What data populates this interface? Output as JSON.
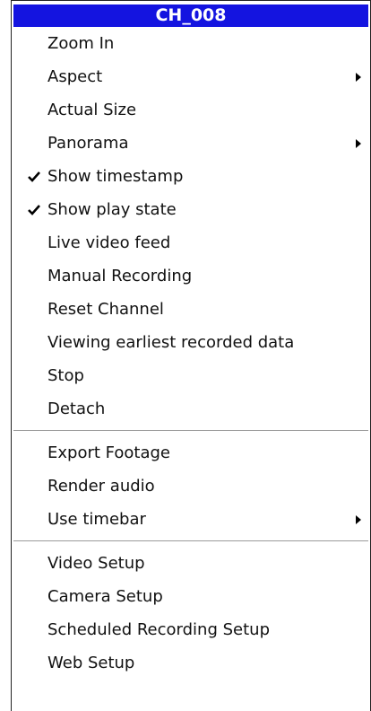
{
  "menu": {
    "title": "CH_008",
    "title_color": "#1414e0",
    "groups": [
      {
        "items": [
          {
            "label": "Zoom In",
            "checked": false,
            "submenu": false
          },
          {
            "label": "Aspect",
            "checked": false,
            "submenu": true
          },
          {
            "label": "Actual Size",
            "checked": false,
            "submenu": false
          },
          {
            "label": "Panorama",
            "checked": false,
            "submenu": true
          },
          {
            "label": "Show timestamp",
            "checked": true,
            "submenu": false
          },
          {
            "label": "Show play state",
            "checked": true,
            "submenu": false
          },
          {
            "label": "Live video feed",
            "checked": false,
            "submenu": false
          },
          {
            "label": "Manual Recording",
            "checked": false,
            "submenu": false
          },
          {
            "label": "Reset Channel",
            "checked": false,
            "submenu": false
          },
          {
            "label": "Viewing earliest recorded data",
            "checked": false,
            "submenu": false
          },
          {
            "label": "Stop",
            "checked": false,
            "submenu": false
          },
          {
            "label": "Detach",
            "checked": false,
            "submenu": false
          }
        ]
      },
      {
        "items": [
          {
            "label": "Export Footage",
            "checked": false,
            "submenu": false
          },
          {
            "label": "Render audio",
            "checked": false,
            "submenu": false
          },
          {
            "label": "Use timebar",
            "checked": false,
            "submenu": true
          }
        ]
      },
      {
        "items": [
          {
            "label": "Video Setup",
            "checked": false,
            "submenu": false
          },
          {
            "label": "Camera Setup",
            "checked": false,
            "submenu": false
          },
          {
            "label": "Scheduled Recording Setup",
            "checked": false,
            "submenu": false
          },
          {
            "label": "Web Setup",
            "checked": false,
            "submenu": false
          }
        ]
      }
    ]
  }
}
